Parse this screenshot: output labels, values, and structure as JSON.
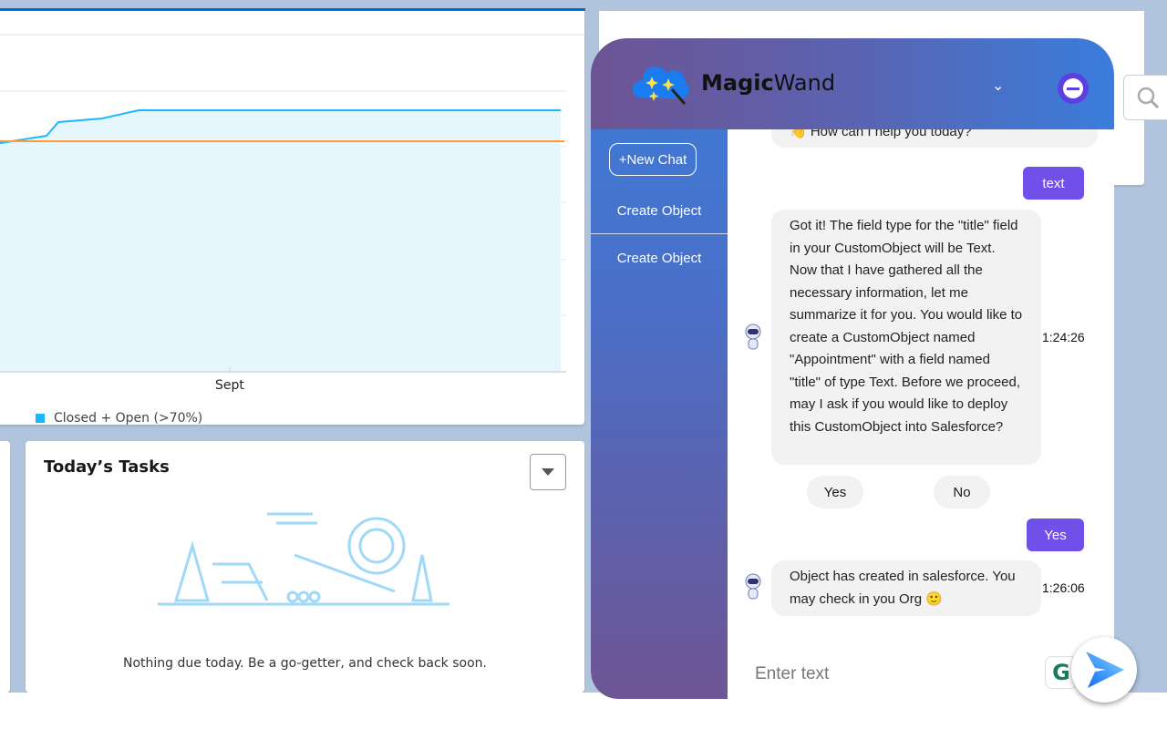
{
  "chart": {
    "x_tick": "Sept",
    "legend": "Closed + Open (>70%)",
    "colors": {
      "area_line": "#1ab9ff",
      "area_fill": "#e6f6fd",
      "goal_line": "#ff9a3c"
    }
  },
  "tasks": {
    "title": "Today’s Tasks",
    "empty_message": "Nothing due today. Be a go-getter, and check back soon."
  },
  "chat": {
    "brand_bold": "Magic",
    "brand_light": "Wand",
    "new_chat": "+New Chat",
    "history": [
      "Create Object",
      "Create Object"
    ],
    "welcome": "👋 How can I help you today?",
    "messages": [
      {
        "from": "user",
        "text": "text"
      },
      {
        "from": "bot",
        "text": "Got it! The field type for the \"title\" field in your CustomObject will be Text. Now that I have gathered all the necessary information, let me summarize it for you. You would like to create a CustomObject named \"Appointment\" with a field named \"title\" of type Text. Before we proceed, may I ask if you would like to deploy this CustomObject into Salesforce?",
        "time": "1:24:26"
      },
      {
        "from": "user",
        "text": "Yes"
      },
      {
        "from": "bot",
        "text": "Object has created in salesforce. You may check in you Org 🙂",
        "time": "1:26:06"
      }
    ],
    "options": [
      "Yes",
      "No"
    ],
    "input_placeholder": "Enter text",
    "accent": "#7050e8"
  }
}
